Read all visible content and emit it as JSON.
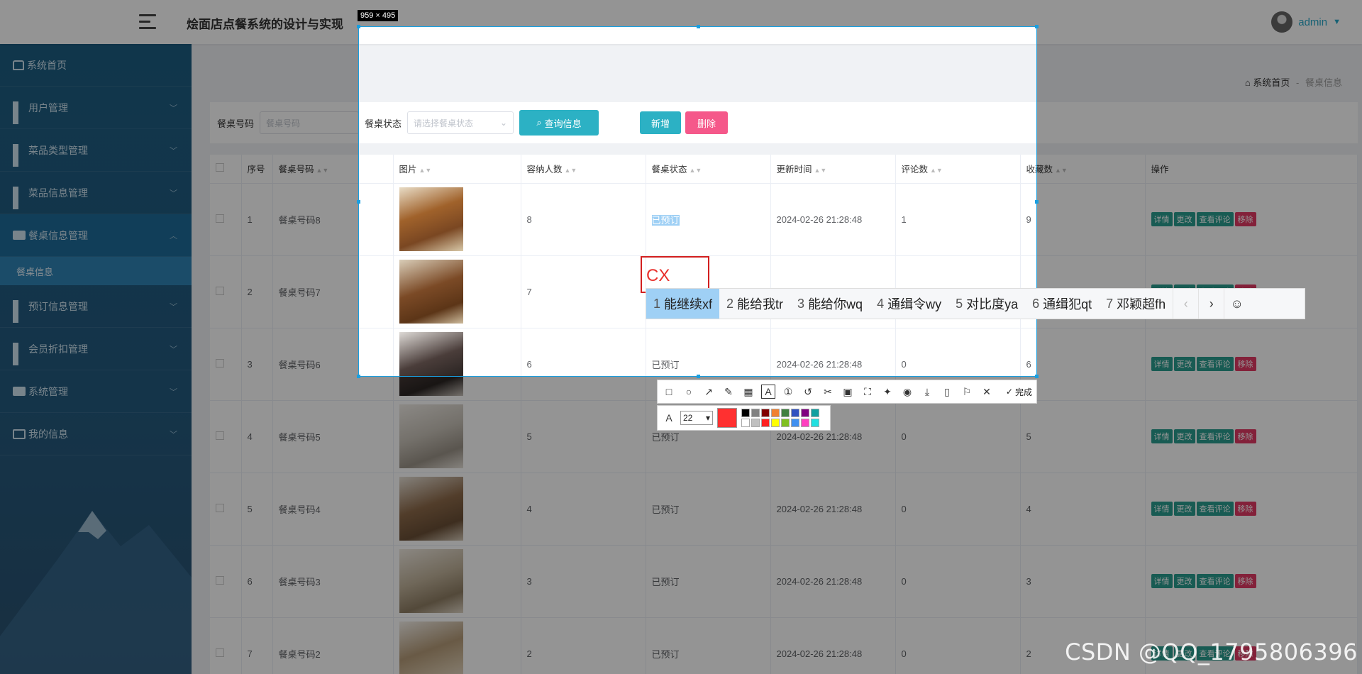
{
  "header": {
    "title": "烩面店点餐系统的设计与实现",
    "username": "admin"
  },
  "sidebar": {
    "items": [
      {
        "label": "系统首页",
        "icon": "home-icon"
      },
      {
        "label": "用户管理",
        "icon": "grid-icon"
      },
      {
        "label": "菜品类型管理",
        "icon": "grid-icon"
      },
      {
        "label": "菜品信息管理",
        "icon": "grid-icon"
      },
      {
        "label": "餐桌信息管理",
        "icon": "briefcase-icon",
        "open": true
      },
      {
        "label": "预订信息管理",
        "icon": "grid-icon"
      },
      {
        "label": "会员折扣管理",
        "icon": "grid-icon"
      },
      {
        "label": "系统管理",
        "icon": "briefcase-icon"
      },
      {
        "label": "我的信息",
        "icon": "card-icon"
      }
    ],
    "submenu": {
      "label": "餐桌信息"
    }
  },
  "breadcrumb": {
    "home": "系统首页",
    "separator": "-",
    "current": "餐桌信息"
  },
  "search": {
    "code_label": "餐桌号码",
    "code_placeholder": "餐桌号码",
    "status_label": "餐桌状态",
    "status_placeholder": "请选择餐桌状态",
    "query_button": "查询信息"
  },
  "actions": {
    "add": "新增",
    "delete": "删除"
  },
  "table": {
    "headers": {
      "index": "序号",
      "code": "餐桌号码",
      "image": "图片",
      "capacity": "容纳人数",
      "status": "餐桌状态",
      "updated": "更新时间",
      "comments": "评论数",
      "favorites": "收藏数",
      "ops": "操作"
    },
    "op_labels": {
      "detail": "详情",
      "edit": "更改",
      "comments": "查看评论",
      "remove": "移除"
    },
    "rows": [
      {
        "index": "1",
        "code": "餐桌号码8",
        "capacity": "8",
        "status": "已预订",
        "updated": "2024-02-26 21:28:48",
        "comments": "1",
        "favorites": "9"
      },
      {
        "index": "2",
        "code": "餐桌号码7",
        "capacity": "7",
        "status": "",
        "updated": "",
        "comments": "",
        "favorites": ""
      },
      {
        "index": "3",
        "code": "餐桌号码6",
        "capacity": "6",
        "status": "已预订",
        "updated": "2024-02-26 21:28:48",
        "comments": "0",
        "favorites": "6"
      },
      {
        "index": "4",
        "code": "餐桌号码5",
        "capacity": "5",
        "status": "已预订",
        "updated": "2024-02-26 21:28:48",
        "comments": "0",
        "favorites": "5"
      },
      {
        "index": "5",
        "code": "餐桌号码4",
        "capacity": "4",
        "status": "已预订",
        "updated": "2024-02-26 21:28:48",
        "comments": "0",
        "favorites": "4"
      },
      {
        "index": "6",
        "code": "餐桌号码3",
        "capacity": "3",
        "status": "已预订",
        "updated": "2024-02-26 21:28:48",
        "comments": "0",
        "favorites": "3"
      },
      {
        "index": "7",
        "code": "餐桌号码2",
        "capacity": "2",
        "status": "已预订",
        "updated": "2024-02-26 21:28:48",
        "comments": "0",
        "favorites": "2"
      }
    ]
  },
  "capture_tool": {
    "size_label": "959 × 495",
    "typed_text": "CX",
    "ime_candidates": [
      {
        "num": "1",
        "text": "能继续xf"
      },
      {
        "num": "2",
        "text": "能给我tr"
      },
      {
        "num": "3",
        "text": "能给你wq"
      },
      {
        "num": "4",
        "text": "通缉令wy"
      },
      {
        "num": "5",
        "text": "对比度ya"
      },
      {
        "num": "6",
        "text": "通缉犯qt"
      },
      {
        "num": "7",
        "text": "邓颖超fh"
      }
    ],
    "done_label": "完成",
    "font_size": "22",
    "current_color": "#ff3030",
    "palette": [
      "#000000",
      "#808080",
      "#800000",
      "#f08030",
      "#408040",
      "#3050c0",
      "#800080",
      "#10a0a0",
      "#ffffff",
      "#c0c0c0",
      "#ff2020",
      "#ffff00",
      "#80c020",
      "#4090f0",
      "#ff40c0",
      "#20e0e0"
    ]
  },
  "watermark": "CSDN @QQ_1795806396"
}
